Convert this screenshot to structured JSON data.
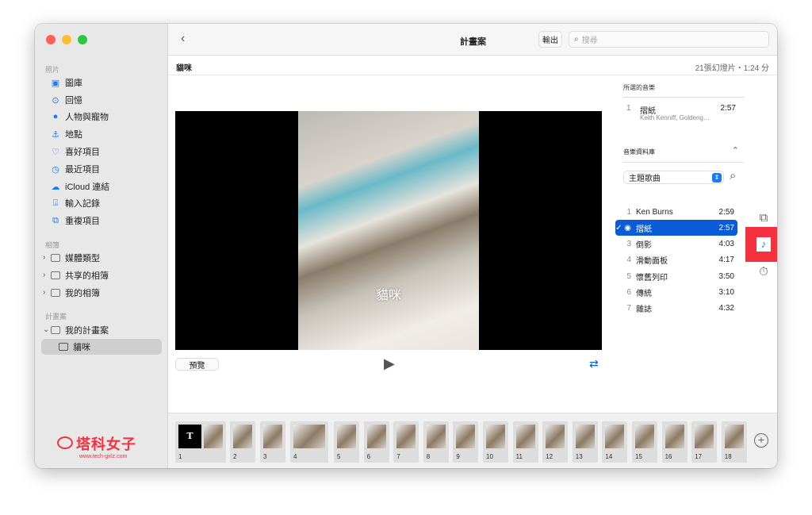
{
  "sidebar": {
    "sections": {
      "photos": "照片",
      "albums": "相簿",
      "projects": "計畫案"
    },
    "photos_items": [
      {
        "label": "圖庫",
        "icon": "photo-library-icon"
      },
      {
        "label": "回憶",
        "icon": "memories-icon"
      },
      {
        "label": "人物與寵物",
        "icon": "people-icon"
      },
      {
        "label": "地點",
        "icon": "places-icon"
      },
      {
        "label": "喜好項目",
        "icon": "heart-icon"
      },
      {
        "label": "最近項目",
        "icon": "clock-icon"
      },
      {
        "label": "iCloud 連結",
        "icon": "icloud-link-icon"
      },
      {
        "label": "輸入記錄",
        "icon": "import-icon"
      },
      {
        "label": "重複項目",
        "icon": "duplicates-icon"
      }
    ],
    "album_items": [
      {
        "label": "媒體類型"
      },
      {
        "label": "共享的相簿"
      },
      {
        "label": "我的相簿"
      }
    ],
    "project_folder": "我的計畫案",
    "project_item": "貓咪"
  },
  "toolbar": {
    "title": "計畫案",
    "export": "輸出",
    "search_placeholder": "搜尋"
  },
  "project": {
    "name": "貓咪",
    "summary": "21張幻燈片・1:24 分"
  },
  "preview": {
    "caption": "貓咪",
    "preview_button": "預覽"
  },
  "music": {
    "selected_header": "所選的音樂",
    "selected": {
      "num": "1",
      "title": "摺紙",
      "duration": "2:57",
      "artist": "Keith Kenniff, Goldeng…"
    },
    "library_header": "音樂資料庫",
    "library_select": "主題歌曲",
    "tracks": [
      {
        "num": "1",
        "title": "Ken Burns",
        "duration": "2:59"
      },
      {
        "num": "",
        "title": "摺紙",
        "duration": "2:57",
        "selected": true
      },
      {
        "num": "3",
        "title": "倒影",
        "duration": "4:03"
      },
      {
        "num": "4",
        "title": "滑動面板",
        "duration": "4:17"
      },
      {
        "num": "5",
        "title": "懷舊列印",
        "duration": "3:50"
      },
      {
        "num": "6",
        "title": "傳統",
        "duration": "3:10"
      },
      {
        "num": "7",
        "title": "雜誌",
        "duration": "4:32"
      }
    ]
  },
  "filmstrip": [
    "1",
    "2",
    "3",
    "4",
    "5",
    "6",
    "7",
    "8",
    "9",
    "10",
    "11",
    "12",
    "13",
    "14",
    "15",
    "16",
    "17",
    "18"
  ],
  "watermark": {
    "name": "塔科女子",
    "url": "www.tech-girlz.com"
  },
  "colors": {
    "accent": "#0a5bd8",
    "highlight": "#f5303f"
  }
}
